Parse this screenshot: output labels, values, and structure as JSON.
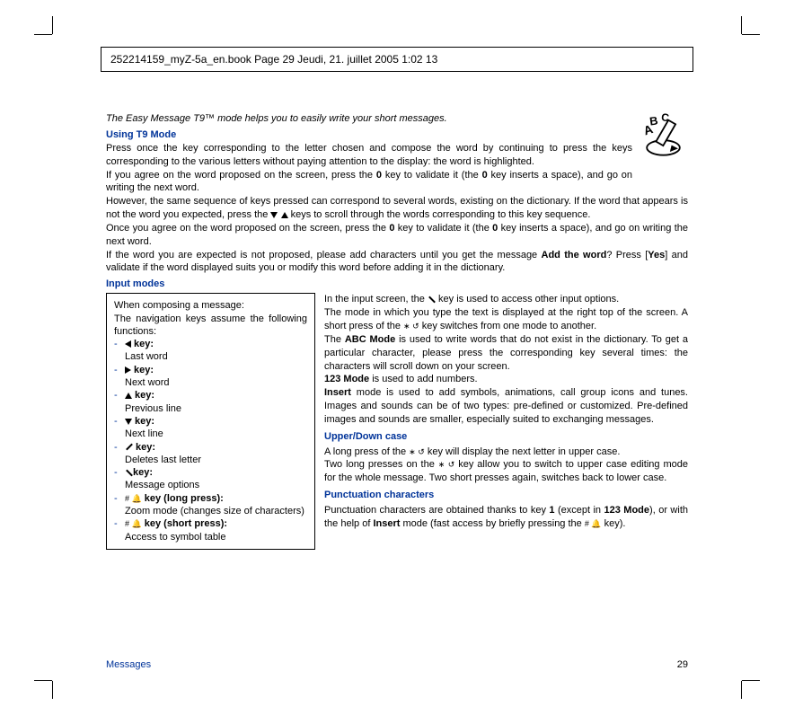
{
  "header": {
    "line": "252214159_myZ-5a_en.book  Page 29  Jeudi, 21. juillet 2005  1:02 13"
  },
  "intro": "The Easy Message T9™ mode helps you to easily write your short messages.",
  "headings": {
    "using_t9": "Using T9 Mode",
    "input_modes": "Input modes",
    "upper_down": "Upper/Down case",
    "punct": "Punctuation characters"
  },
  "para": {
    "p1": "Press once the key corresponding to the letter chosen and compose the word by continuing to press the keys corresponding to the various letters without paying attention to the display: the word is highlighted.",
    "p2a": "If you agree on the word proposed on the screen, press the ",
    "p2b": " key to validate it (the ",
    "p2c": " key inserts a space), and go on writing the next word.",
    "p3a": "However, the same sequence of keys pressed can correspond to several words, existing on the dictionary. If the word that appears is not the word you expected, press the ",
    "p3b": " keys to scroll through the words corresponding to this key sequence.",
    "p4a": "Once you agree on the word proposed on the screen, press the ",
    "p4b": " key to validate it (the ",
    "p4c": " key inserts a space), and go on writing the next word.",
    "p5a": "If the word you are expected is not proposed, please add characters until you get the message ",
    "p5b": "? Press [",
    "p5c": "] and validate if the word displayed suits you or modify this word before adding it in the dictionary.",
    "right1a": "In the input screen, the ",
    "right1b": " key is used to access other input options.",
    "right2": "The mode in which you type the text is displayed at the right top of the screen. A short press of the ",
    "right2b": " key switches from one mode to another.",
    "right3a": "The ",
    "right3b": " is used to write words that do not exist in the dictionary. To get a particular character, please press the corresponding key several times: the characters will scroll down on your screen.",
    "right4": " is used to add numbers.",
    "right5a": " mode is used to add symbols, animations, call group icons and tunes. Images and sounds can be of two types: pre-defined or customized. Pre-defined images and sounds are smaller, especially suited to exchanging messages.",
    "right6": "A long press of the ",
    "right6b": " key will display the next letter in upper case.",
    "right7": "Two long presses on the ",
    "right7b": " key allow you to switch to upper case editing mode for the whole message. Two short presses again, switches back to lower case.",
    "right8a": "Punctuation characters are obtained thanks to key ",
    "right8b": " (except in ",
    "right8c": "), or with the help of ",
    "right8d": " mode (fast access by briefly pressing the ",
    "right8e": " key)."
  },
  "bold": {
    "zero": "0",
    "add_word": "Add the word",
    "yes": "Yes",
    "abc_mode": "ABC Mode",
    "mode_123": "123 Mode",
    "insert": "Insert",
    "key1": "1"
  },
  "navbox": {
    "lead1": "When composing a message:",
    "lead2": "The navigation keys assume the following functions:",
    "k1": " key:",
    "v1": "Last word",
    "k2": " key:",
    "v2": "Next word",
    "k3": " key:",
    "v3": "Previous line",
    "k4": " key:",
    "v4": "Next line",
    "k5": " key:",
    "v5": "Deletes last letter",
    "k6": "key:",
    "v6": "Message options",
    "k7": " key (long press):",
    "v7": "Zoom mode (changes size of characters)",
    "k8": " key (short press):",
    "v8": "Access to symbol table"
  },
  "footer": {
    "section": "Messages",
    "page": "29"
  },
  "icons": {
    "abc_pencil": "abc-pencil-icon",
    "star": "∗",
    "hash": "#",
    "bell": "🔔"
  }
}
